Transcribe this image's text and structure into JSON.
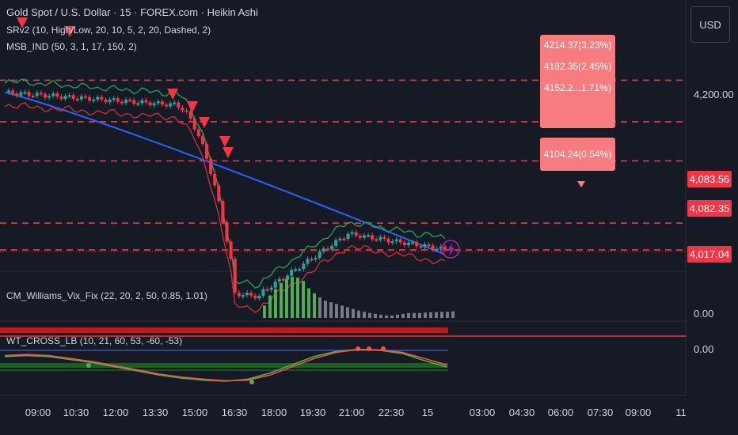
{
  "header": {
    "title": "Gold Spot / U.S. Dollar · 15 · FOREX.com · Heikin Ashi",
    "indicators": [
      "SRv2 (10, High/Low, 20, 10, 5, 2, 20, Dashed, 2)",
      "MSB_IND (50, 3, 1, 17, 150, 2)"
    ]
  },
  "currency_button": "USD",
  "price_axis": {
    "tick": "4,200.00",
    "tags": [
      {
        "label": "4,083.56",
        "value": 4083.56
      },
      {
        "label": "4,082.35",
        "value": 4082.35
      },
      {
        "label": "4,017.04",
        "value": 4017.04
      }
    ]
  },
  "targets": [
    {
      "label": "4214.37(3.23%)",
      "value": 4214.37
    },
    {
      "label": "4182.35(2.45%)",
      "value": 4182.35
    },
    {
      "label": "4152.2...1.71%)",
      "value": 4152.2
    },
    {
      "label": "4104.24(0.54%)",
      "value": 4104.24
    }
  ],
  "panes": {
    "vix": {
      "title": "CM_Williams_Vix_Fix (22, 20, 2, 50, 0.85, 1.01)",
      "axis": "0.00"
    },
    "wt": {
      "title": "WT_CROSS_LB (10, 21, 60, 53, -60, -53)",
      "axis": "0.00"
    }
  },
  "time_axis": [
    "09:00",
    "10:30",
    "12:00",
    "13:30",
    "15:00",
    "16:30",
    "18:00",
    "19:30",
    "21:00",
    "22:30",
    "15",
    "03:00",
    "04:30",
    "06:00",
    "07:30",
    "09:00",
    "11"
  ],
  "icons": {
    "lightning": "lightning-icon"
  },
  "colors": {
    "bg": "#161a25",
    "bull": "#26a69a",
    "bear": "#f23645",
    "ma": "#2962ff",
    "upper_band": "#1e9e5a",
    "lower_band": "#c0303a",
    "callout": "#f77c80",
    "vix_green": "#4caf50",
    "vix_gray": "#787b86",
    "accent": "#9c27b0"
  },
  "chart_data": [
    {
      "type": "candlestick",
      "title": "Gold Spot / U.S. Dollar · 15 · FOREX.com · Heikin Ashi",
      "x": [
        "09:00",
        "10:30",
        "12:00",
        "13:30",
        "15:00",
        "16:30",
        "18:00",
        "19:30",
        "21:00",
        "22:30",
        "15"
      ],
      "close_approx": [
        4200,
        4190,
        4191,
        4186,
        4176,
        4120,
        4045,
        4070,
        4090,
        4085,
        4082.35
      ],
      "horizontal_levels": [
        4214.37,
        4182.35,
        4152.2,
        4104.24,
        4083.56
      ],
      "last_price": 4082.35,
      "low_marker": 4017.04,
      "ylim": [
        4000,
        4240
      ]
    },
    {
      "type": "bar",
      "title": "CM_Williams_Vix_Fix (22, 20, 2, 50, 0.85, 1.01)",
      "values": [
        0,
        0,
        0,
        0,
        0,
        0,
        0,
        0,
        0,
        0,
        0,
        0,
        0,
        0,
        0,
        0,
        0,
        0,
        0,
        0,
        0,
        0,
        0,
        0,
        0,
        0,
        0,
        0,
        0,
        0,
        0,
        0,
        0,
        0,
        0,
        0,
        0,
        0,
        0,
        0,
        0,
        0,
        0,
        0,
        0,
        0,
        0.3,
        0.55,
        0.7,
        0.85,
        0.95,
        1.0,
        0.98,
        0.9,
        0.72,
        0.6,
        0.5,
        0.42,
        0.38,
        0.34,
        0.3,
        0.26,
        0.22,
        0.18,
        0.15,
        0.12,
        0.1,
        0.08,
        0.06,
        0.06,
        0.08,
        0.1,
        0.12,
        0.12,
        0.12,
        0.13,
        0.14,
        0.14,
        0.15,
        0.15,
        0.16
      ],
      "highlight_range": [
        46,
        55
      ]
    },
    {
      "type": "line",
      "title": "WT_CROSS_LB (10, 21, 60, 53, -60, -53)",
      "series": [
        {
          "values": [
            0.2,
            0.25,
            0.2,
            0.05,
            -0.1,
            -0.3,
            -0.5,
            -0.7,
            -0.85,
            -0.95,
            -1.0,
            -0.9,
            -0.6,
            -0.2,
            0.2,
            0.45,
            0.55,
            0.5,
            0.35,
            0.0,
            -0.3
          ]
        },
        {
          "values": [
            0.25,
            0.3,
            0.25,
            0.1,
            -0.05,
            -0.25,
            -0.45,
            -0.65,
            -0.8,
            -0.9,
            -0.98,
            -0.95,
            -0.7,
            -0.3,
            0.1,
            0.4,
            0.55,
            0.52,
            0.4,
            0.1,
            -0.2
          ]
        }
      ]
    }
  ]
}
